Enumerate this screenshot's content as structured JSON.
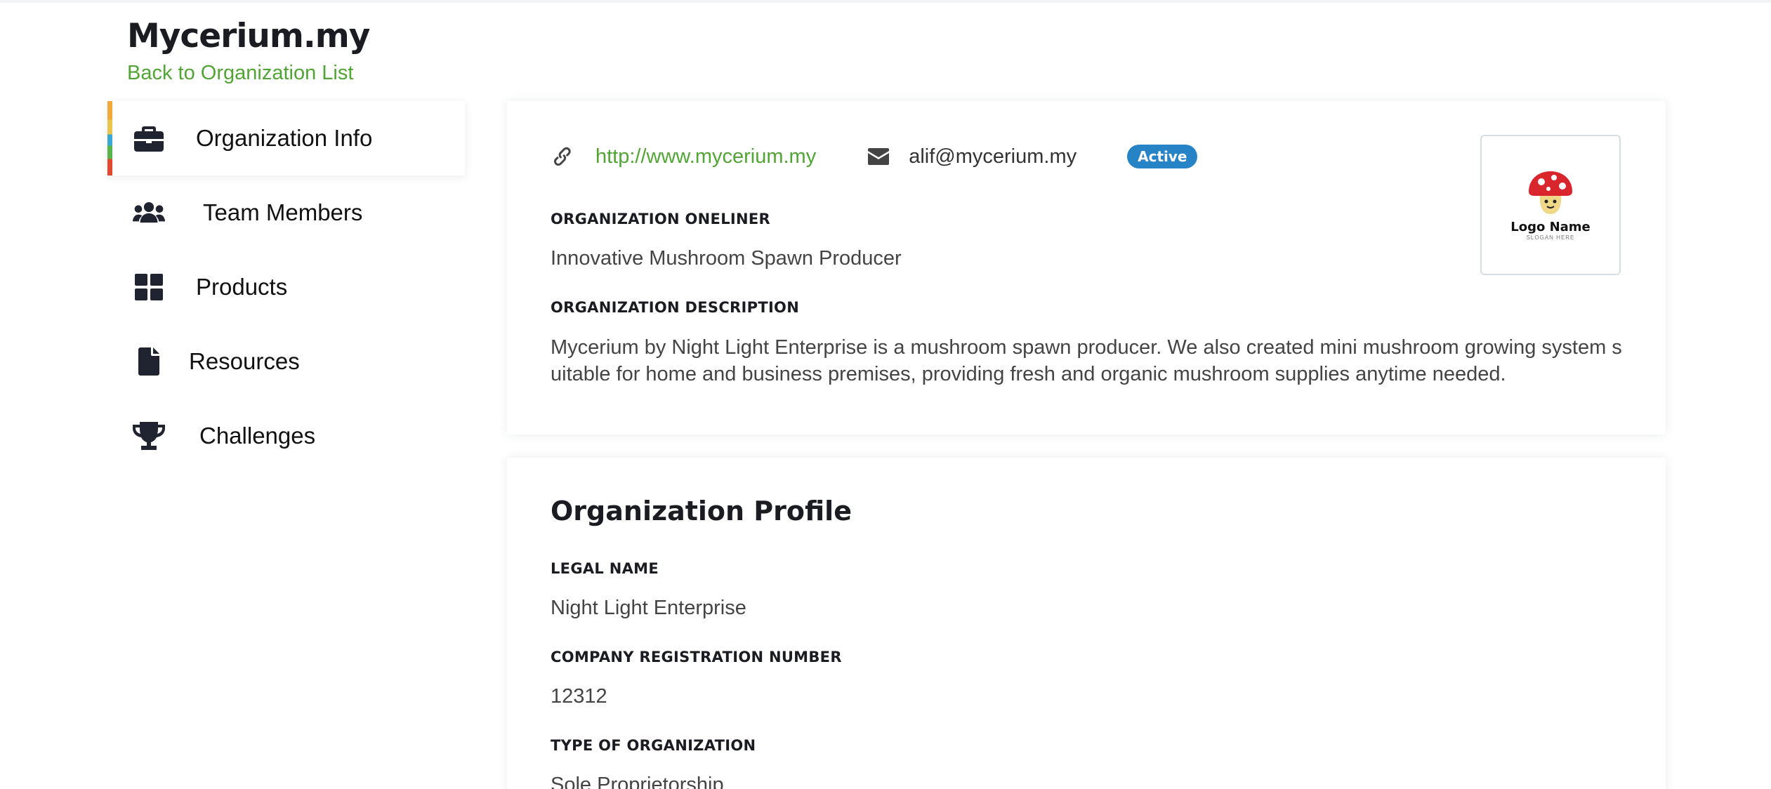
{
  "header": {
    "brand": "Mycerium.my",
    "back_link": "Back to Organization List"
  },
  "sidebar": {
    "items": [
      {
        "label": "Organization Info",
        "icon": "briefcase-icon",
        "active": true
      },
      {
        "label": "Team Members",
        "icon": "users-icon",
        "active": false
      },
      {
        "label": "Products",
        "icon": "grid-icon",
        "active": false
      },
      {
        "label": "Resources",
        "icon": "file-icon",
        "active": false
      },
      {
        "label": "Challenges",
        "icon": "trophy-icon",
        "active": false
      }
    ]
  },
  "org_info": {
    "website": "http://www.mycerium.my",
    "email": "alif@mycerium.my",
    "status": "Active",
    "oneliner_label": "ORGANIZATION ONELINER",
    "oneliner": "Innovative Mushroom Spawn Producer",
    "description_label": "ORGANIZATION DESCRIPTION",
    "description": "Mycerium by Night Light Enterprise is a mushroom spawn producer. We also created mini mushroom growing system suitable for home and business premises, providing fresh and organic mushroom supplies anytime needed.",
    "logo_name": "Logo Name",
    "logo_slogan": "SLOGAN HERE"
  },
  "profile": {
    "title": "Organization Profile",
    "legal_name_label": "LEGAL NAME",
    "legal_name": "Night Light Enterprise",
    "reg_number_label": "COMPANY REGISTRATION NUMBER",
    "reg_number": "12312",
    "org_type_label": "TYPE OF ORGANIZATION",
    "org_type": "Sole Proprietorship"
  },
  "colors": {
    "accent_green": "#52a436",
    "badge_blue": "#2683c6",
    "text_dark": "#1b1c22"
  }
}
